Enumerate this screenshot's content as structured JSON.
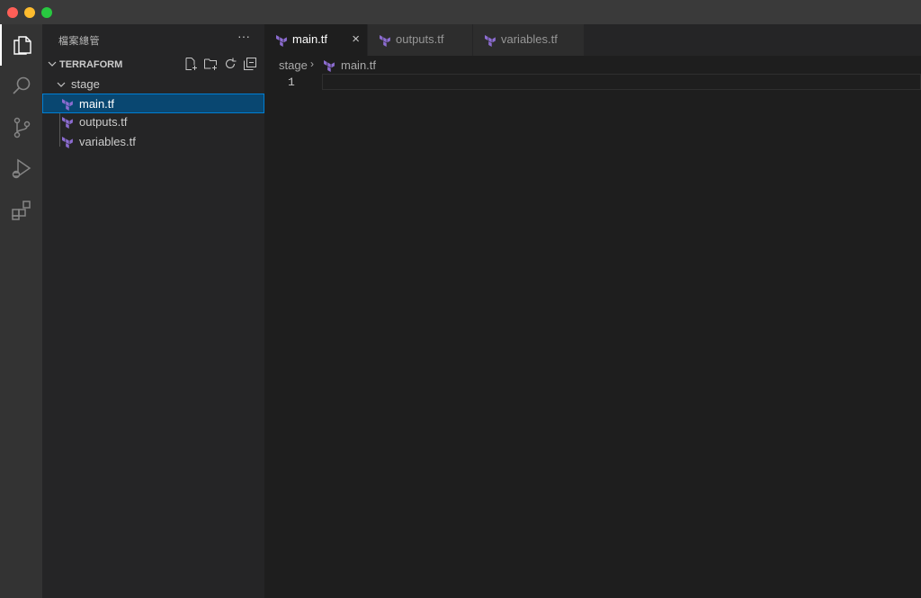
{
  "colors": {
    "accent": "#007fd4",
    "selection": "#094771",
    "terraform": "#8c6cd1"
  },
  "window": {
    "buttons": [
      "close",
      "minimize",
      "maximize"
    ]
  },
  "activity_bar": {
    "items": [
      {
        "name": "explorer",
        "icon": "files-icon",
        "active": true
      },
      {
        "name": "search",
        "icon": "search-icon"
      },
      {
        "name": "source-control",
        "icon": "source-control-icon"
      },
      {
        "name": "run-debug",
        "icon": "run-debug-icon"
      },
      {
        "name": "extensions",
        "icon": "extensions-icon"
      }
    ]
  },
  "sidebar": {
    "title": "檔案總管",
    "more": "···",
    "section": {
      "title": "TERRAFORM",
      "actions": [
        "new-file-icon",
        "new-folder-icon",
        "refresh-icon",
        "collapse-all-icon"
      ]
    },
    "tree": {
      "folder": "stage",
      "files": [
        {
          "label": "main.tf",
          "selected": true
        },
        {
          "label": "outputs.tf"
        },
        {
          "label": "variables.tf"
        }
      ]
    }
  },
  "tabs": [
    {
      "label": "main.tf",
      "active": true,
      "close": "×"
    },
    {
      "label": "outputs.tf"
    },
    {
      "label": "variables.tf"
    }
  ],
  "breadcrumb": {
    "folder": "stage",
    "separator": "›",
    "file": "main.tf"
  },
  "editor": {
    "line_numbers": [
      "1"
    ],
    "content": ""
  }
}
